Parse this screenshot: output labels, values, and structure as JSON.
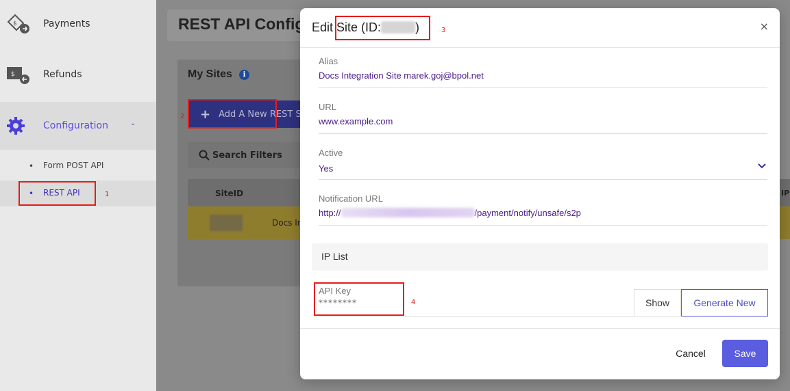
{
  "sidebar": {
    "items": [
      {
        "label": "Payments",
        "icon": "payments-icon"
      },
      {
        "label": "Refunds",
        "icon": "refunds-icon"
      },
      {
        "label": "Configuration",
        "icon": "gear-icon"
      }
    ],
    "subitems": [
      {
        "label": "Form POST API"
      },
      {
        "label": "REST API"
      }
    ]
  },
  "page": {
    "title": "REST API Config",
    "panel_title": "My Sites",
    "add_button": "Add A New REST Si",
    "search_filters": "Search Filters",
    "table": {
      "col_siteid": "SiteID",
      "row_text": "Docs In",
      "col_right": "IP"
    }
  },
  "modal": {
    "title_prefix": "Edit ",
    "title_site": "Site (ID:",
    "title_suffix": ")",
    "close": "×",
    "fields": {
      "alias_label": "Alias",
      "alias_value": "Docs Integration Site marek.goj@bpol.net",
      "url_label": "URL",
      "url_value": "www.example.com",
      "active_label": "Active",
      "active_value": "Yes",
      "notif_label": "Notification URL",
      "notif_prefix": "http://",
      "notif_suffix": "/payment/notify/unsafe/s2p"
    },
    "ip_list": "IP List",
    "api_key_label": "API Key",
    "api_key_value": "********",
    "show_button": "Show",
    "generate_button": "Generate New",
    "cancel_button": "Cancel",
    "save_button": "Save"
  },
  "annotations": [
    "1",
    "2",
    "3",
    "4"
  ],
  "colors": {
    "accent": "#5a5ddf",
    "value_text": "#4a1a8a",
    "annotation": "#e51c1c"
  }
}
